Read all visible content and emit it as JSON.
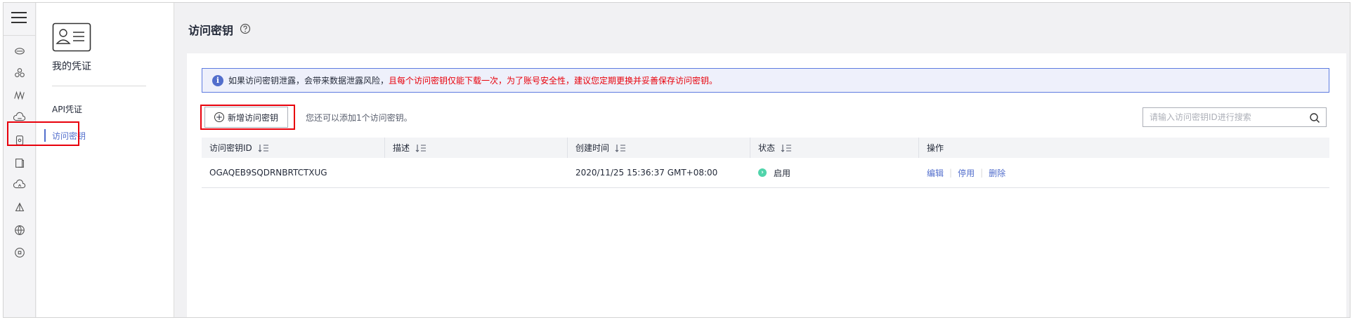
{
  "sidebar": {
    "title": "我的凭证",
    "items": [
      {
        "label": "API凭证"
      },
      {
        "label": "访问密钥"
      }
    ]
  },
  "header": {
    "title": "访问密钥"
  },
  "alert": {
    "text_normal": "如果访问密钥泄露，会带来数据泄露风险，",
    "text_warning": "且每个访问密钥仅能下载一次，为了账号安全性，建议您定期更换并妥善保存访问密钥。"
  },
  "toolbar": {
    "add_label": "新增访问密钥",
    "hint": "您还可以添加1个访问密钥。",
    "search_placeholder": "请输入访问密钥ID进行搜索"
  },
  "table": {
    "columns": [
      "访问密钥ID",
      "描述",
      "创建时间",
      "状态",
      "操作"
    ],
    "rows": [
      {
        "id": "OGAQEB9SQDRNBRTCTXUG",
        "description": "",
        "created": "2020/11/25 15:36:37 GMT+08:00",
        "status": "启用",
        "actions": [
          "编辑",
          "停用",
          "删除"
        ]
      }
    ]
  },
  "colors": {
    "accent": "#526ecc",
    "warning": "#e8000b",
    "status_enabled": "#50d4ab"
  }
}
